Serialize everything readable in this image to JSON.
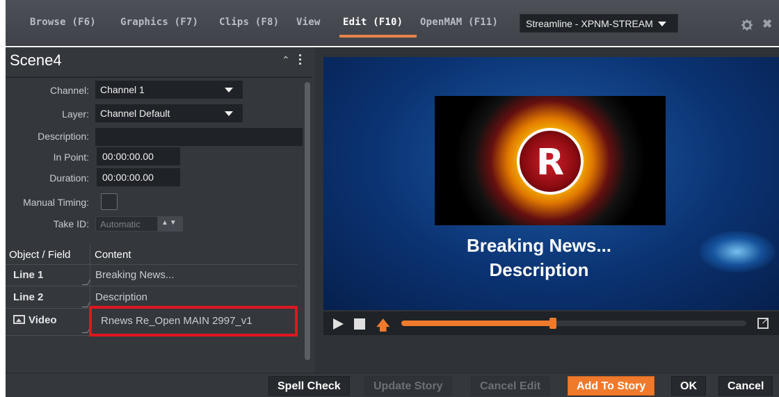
{
  "nav": {
    "tabs": [
      {
        "label": "Browse (F6)"
      },
      {
        "label": "Graphics (F7)"
      },
      {
        "label": "Clips (F8)"
      },
      {
        "label": "View"
      },
      {
        "label": "Edit (F10)",
        "active": true
      },
      {
        "label": "OpenMAM (F11)"
      }
    ],
    "streamline_select": "Streamline - XPNM-STREAM",
    "icons": [
      "gear-icon",
      "close-icon"
    ],
    "close_glyph": "✖",
    "accent": "#e8834a"
  },
  "scene": {
    "title": "Scene4",
    "collapse_glyph": "⌃",
    "fields": {
      "channel_label": "Channel:",
      "channel_value": "Channel 1",
      "layer_label": "Layer:",
      "layer_value": "Channel Default",
      "description_label": "Description:",
      "description_value": "",
      "in_point_label": "In Point:",
      "in_point_value": "00:00:00.00",
      "duration_label": "Duration:",
      "duration_value": "00:00:00.00",
      "manual_timing_label": "Manual Timing:",
      "manual_timing_checked": false,
      "take_id_label": "Take ID:",
      "take_id_placeholder": "Automatic",
      "spin_glyph": "▲▼"
    },
    "table": {
      "headers": [
        "Object / Field",
        "Content"
      ],
      "rows": [
        {
          "field": "Line 1",
          "content": "Breaking News..."
        },
        {
          "field": "Line 2",
          "content": "Description"
        },
        {
          "field": "Video",
          "content": "Rnews Re_Open MAIN 2997_v1",
          "icon": "image-icon",
          "highlighted": true
        }
      ],
      "highlight_color": "#e0171f"
    }
  },
  "preview": {
    "logo_letter": "R",
    "line1": "Breaking News...",
    "line2": "Description",
    "up_arrow_glyph": "🡅",
    "progress_fraction": 0.44,
    "controls": [
      "play-icon",
      "stop-icon",
      "take-icon",
      "popout-icon"
    ]
  },
  "footer": {
    "buttons": [
      {
        "label": "Spell Check",
        "state": "normal"
      },
      {
        "label": "Update Story",
        "state": "disabled"
      },
      {
        "label": "Cancel Edit",
        "state": "disabled"
      },
      {
        "label": "Add To Story",
        "state": "primary"
      },
      {
        "label": "OK",
        "state": "normal"
      },
      {
        "label": "Cancel",
        "state": "normal"
      }
    ],
    "primary_color": "#f07a2c"
  }
}
